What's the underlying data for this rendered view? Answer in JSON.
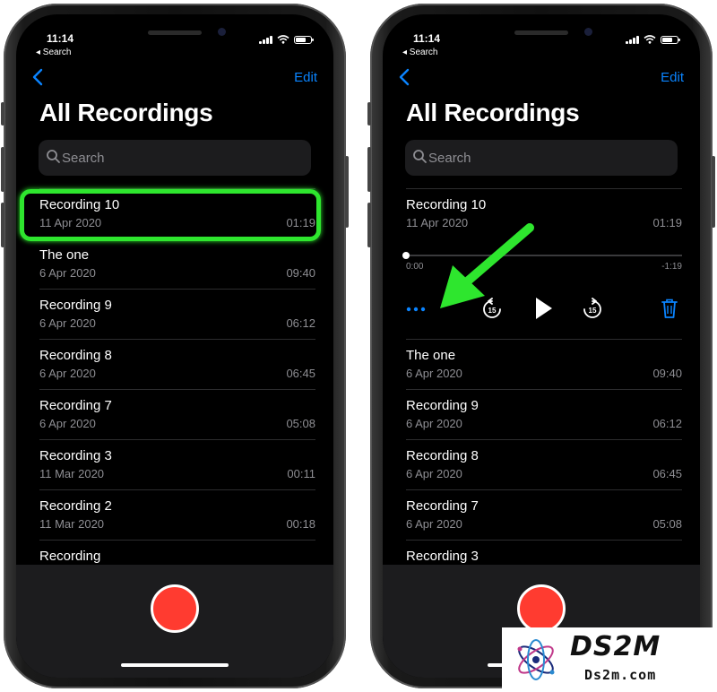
{
  "colors": {
    "accent": "#0a84ff",
    "highlight": "#2ee62e",
    "record": "#ff3b30",
    "background": "#000000",
    "panel": "#1c1c1e"
  },
  "status_bar": {
    "time": "11:14",
    "back_app": "◂ Search"
  },
  "nav": {
    "back_icon": "chevron-left-icon",
    "edit_label": "Edit"
  },
  "page_title": "All Recordings",
  "search": {
    "placeholder": "Search"
  },
  "left_phone": {
    "recordings": [
      {
        "name": "Recording 10",
        "date": "11 Apr 2020",
        "duration": "01:19"
      },
      {
        "name": "The one",
        "date": "6 Apr 2020",
        "duration": "09:40"
      },
      {
        "name": "Recording 9",
        "date": "6 Apr 2020",
        "duration": "06:12"
      },
      {
        "name": "Recording 8",
        "date": "6 Apr 2020",
        "duration": "06:45"
      },
      {
        "name": "Recording 7",
        "date": "6 Apr 2020",
        "duration": "05:08"
      },
      {
        "name": "Recording 3",
        "date": "11 Mar 2020",
        "duration": "00:11"
      },
      {
        "name": "Recording 2",
        "date": "11 Mar 2020",
        "duration": "00:18"
      },
      {
        "name": "Recording",
        "date": "",
        "duration": ""
      }
    ]
  },
  "right_phone": {
    "expanded": {
      "name": "Recording 10",
      "date": "11 Apr 2020",
      "duration": "01:19"
    },
    "player": {
      "elapsed": "0:00",
      "remaining": "-1:19",
      "progress": 0,
      "skip_back_seconds": "15",
      "skip_forward_seconds": "15"
    },
    "recordings": [
      {
        "name": "The one",
        "date": "6 Apr 2020",
        "duration": "09:40"
      },
      {
        "name": "Recording 9",
        "date": "6 Apr 2020",
        "duration": "06:12"
      },
      {
        "name": "Recording 8",
        "date": "6 Apr 2020",
        "duration": "06:45"
      },
      {
        "name": "Recording 7",
        "date": "6 Apr 2020",
        "duration": "05:08"
      },
      {
        "name": "Recording 3",
        "date": "",
        "duration": ""
      }
    ]
  },
  "watermark": {
    "brand": "DS2M",
    "url": "Ds2m.com"
  }
}
